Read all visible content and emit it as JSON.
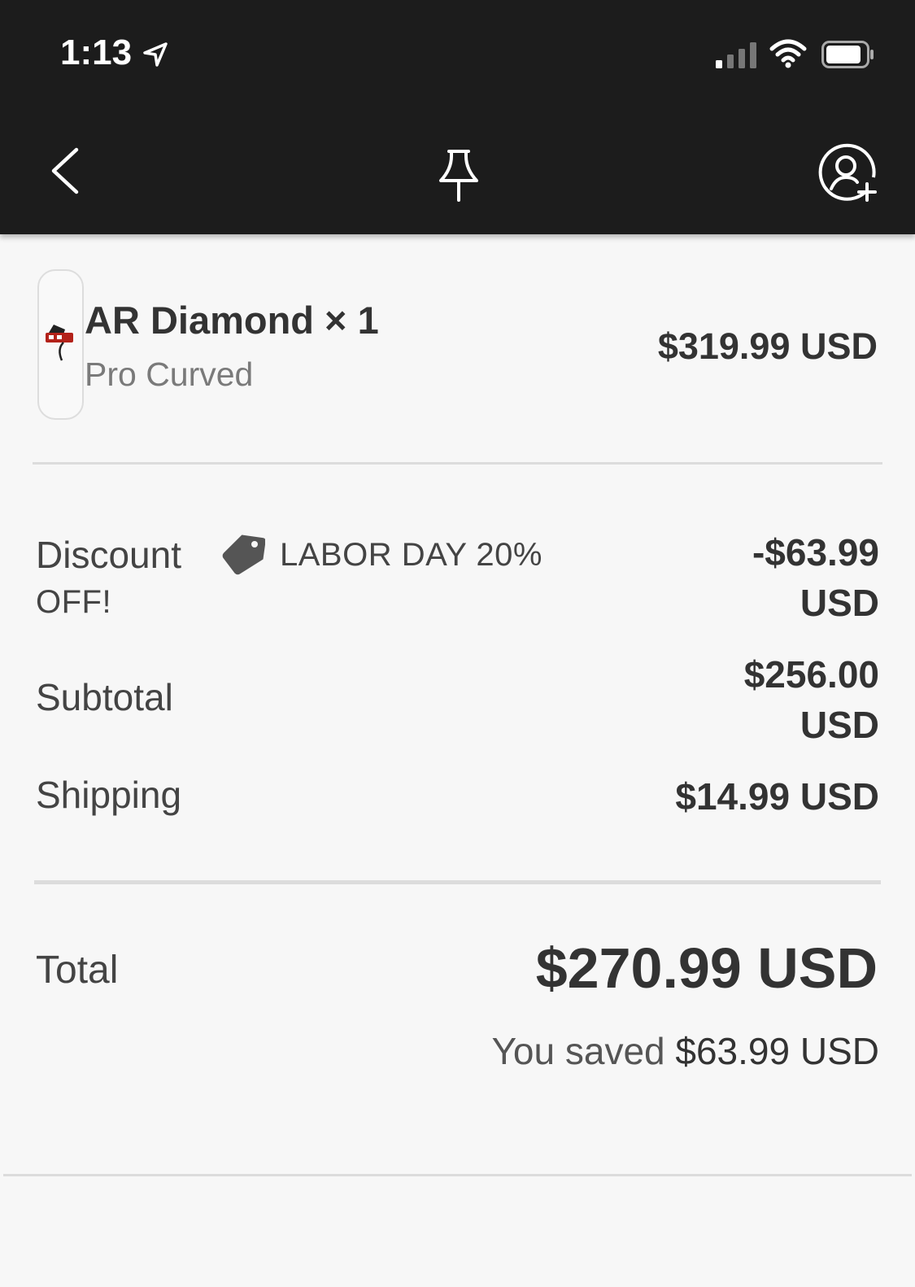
{
  "status_bar": {
    "time": "1:13",
    "icons": [
      "location-arrow-icon",
      "cell-signal-icon",
      "wifi-icon",
      "battery-icon"
    ]
  },
  "nav": {
    "icons": [
      "chevron-left-icon",
      "pin-icon",
      "add-user-icon"
    ]
  },
  "product": {
    "name": "AR Diamond × 1",
    "variant": "Pro Curved",
    "price": "$319.99 USD"
  },
  "summary": {
    "discount_label": "Discount",
    "discount_code": "LABOR DAY 20%",
    "discount_code_suffix": "OFF!",
    "discount_amount": "-$63.99 USD",
    "subtotal_label": "Subtotal",
    "subtotal_amount": "$256.00 USD",
    "shipping_label": "Shipping",
    "shipping_amount": "$14.99 USD",
    "total_label": "Total",
    "total_amount": "$270.99 USD",
    "saved_label": "You saved",
    "saved_amount": "$63.99 USD"
  },
  "colors": {
    "topbar": "#1c1c1c",
    "background": "#f7f7f7",
    "text": "#333333",
    "muted": "#7a7a7a",
    "divider": "#dcdcdc"
  }
}
